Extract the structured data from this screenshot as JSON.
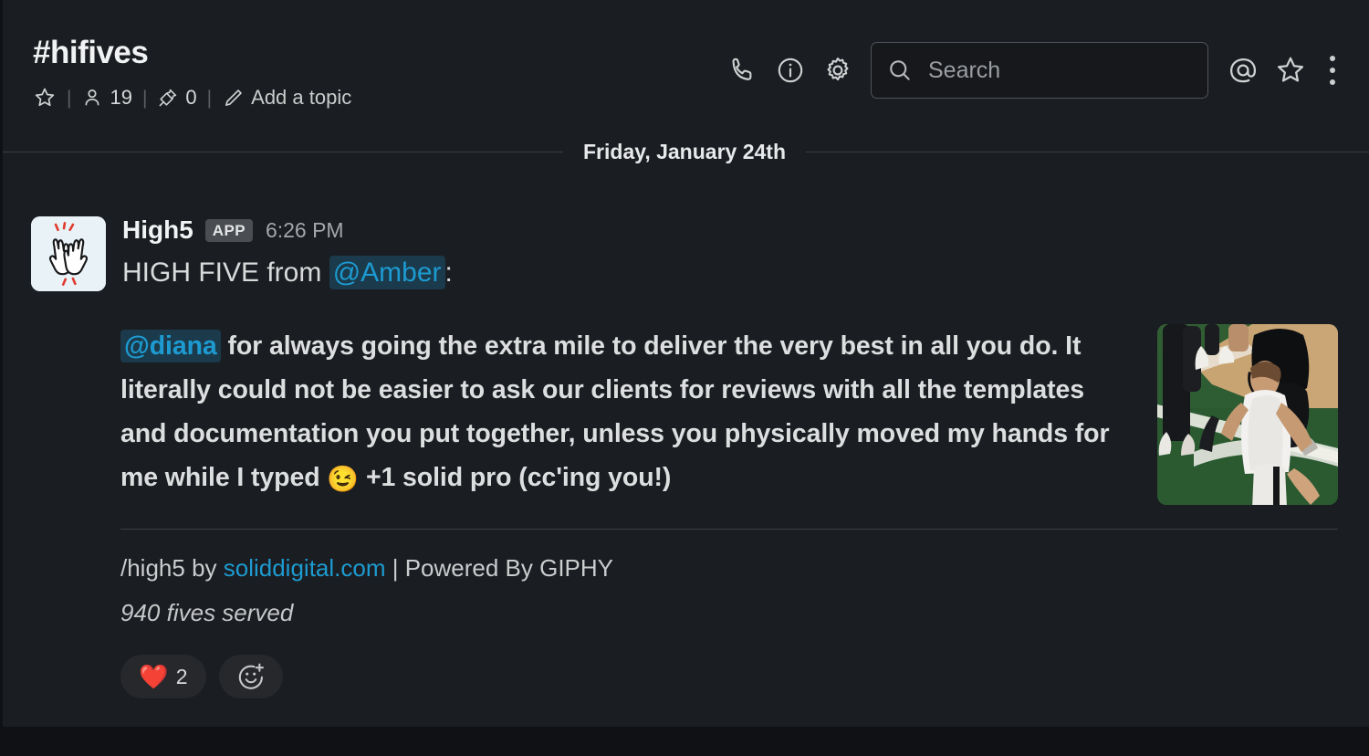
{
  "channel": {
    "name": "#hifives",
    "star_icon": "star-outline-icon",
    "members_icon": "person-icon",
    "members_count": "19",
    "pins_icon": "pin-icon",
    "pins_count": "0",
    "topic_icon": "pencil-icon",
    "topic_placeholder": "Add a topic",
    "separator": "|"
  },
  "toolbar": {
    "call_icon": "phone-icon",
    "info_icon": "info-circle-icon",
    "settings_icon": "gear-icon",
    "mentions_icon": "at-sign-icon",
    "starred_icon": "star-outline-icon",
    "more_icon": "kebab-menu-icon"
  },
  "search": {
    "icon": "search-icon",
    "placeholder": "Search",
    "value": ""
  },
  "divider": {
    "date_label": "Friday, January 24th"
  },
  "message": {
    "avatar_icon": "high-five-hands-icon",
    "sender": "High5",
    "app_badge": "APP",
    "timestamp": "6:26 PM",
    "text_prefix": "HIGH FIVE from ",
    "mention": "@Amber",
    "text_suffix": ":"
  },
  "attachment": {
    "mention": "@diana",
    "body": " for always going the extra mile to deliver the very best in all you do. It literally could not be easier to ask our clients for reviews with all the templates and documentation you put together, unless you physically moved my hands for me while I typed ",
    "emoji": "😉",
    "body_tail": " +1 solid pro (cc'ing you!)",
    "thumbnail_alt": "basketball-court-gif",
    "footer_prefix": "/high5 by ",
    "footer_link": "soliddigital.com",
    "footer_suffix": " | Powered By GIPHY",
    "footer_sub": "940 fives served"
  },
  "reactions": {
    "items": [
      {
        "emoji": "❤️",
        "count": "2",
        "name": "heart"
      }
    ],
    "add_icon": "add-reaction-icon"
  },
  "colors": {
    "background": "#1a1d21",
    "link": "#1d9bd1",
    "mention_bg": "#1b3a4b",
    "text": "#d1d2d3"
  }
}
